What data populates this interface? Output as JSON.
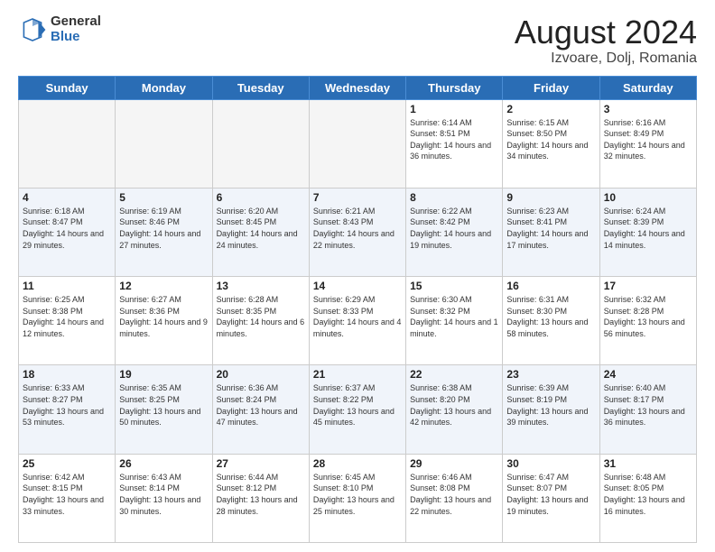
{
  "header": {
    "logo_general": "General",
    "logo_blue": "Blue",
    "month_title": "August 2024",
    "location": "Izvoare, Dolj, Romania"
  },
  "days_of_week": [
    "Sunday",
    "Monday",
    "Tuesday",
    "Wednesday",
    "Thursday",
    "Friday",
    "Saturday"
  ],
  "weeks": [
    [
      {
        "day": "",
        "info": ""
      },
      {
        "day": "",
        "info": ""
      },
      {
        "day": "",
        "info": ""
      },
      {
        "day": "",
        "info": ""
      },
      {
        "day": "1",
        "info": "Sunrise: 6:14 AM\nSunset: 8:51 PM\nDaylight: 14 hours and 36 minutes."
      },
      {
        "day": "2",
        "info": "Sunrise: 6:15 AM\nSunset: 8:50 PM\nDaylight: 14 hours and 34 minutes."
      },
      {
        "day": "3",
        "info": "Sunrise: 6:16 AM\nSunset: 8:49 PM\nDaylight: 14 hours and 32 minutes."
      }
    ],
    [
      {
        "day": "4",
        "info": "Sunrise: 6:18 AM\nSunset: 8:47 PM\nDaylight: 14 hours and 29 minutes."
      },
      {
        "day": "5",
        "info": "Sunrise: 6:19 AM\nSunset: 8:46 PM\nDaylight: 14 hours and 27 minutes."
      },
      {
        "day": "6",
        "info": "Sunrise: 6:20 AM\nSunset: 8:45 PM\nDaylight: 14 hours and 24 minutes."
      },
      {
        "day": "7",
        "info": "Sunrise: 6:21 AM\nSunset: 8:43 PM\nDaylight: 14 hours and 22 minutes."
      },
      {
        "day": "8",
        "info": "Sunrise: 6:22 AM\nSunset: 8:42 PM\nDaylight: 14 hours and 19 minutes."
      },
      {
        "day": "9",
        "info": "Sunrise: 6:23 AM\nSunset: 8:41 PM\nDaylight: 14 hours and 17 minutes."
      },
      {
        "day": "10",
        "info": "Sunrise: 6:24 AM\nSunset: 8:39 PM\nDaylight: 14 hours and 14 minutes."
      }
    ],
    [
      {
        "day": "11",
        "info": "Sunrise: 6:25 AM\nSunset: 8:38 PM\nDaylight: 14 hours and 12 minutes."
      },
      {
        "day": "12",
        "info": "Sunrise: 6:27 AM\nSunset: 8:36 PM\nDaylight: 14 hours and 9 minutes."
      },
      {
        "day": "13",
        "info": "Sunrise: 6:28 AM\nSunset: 8:35 PM\nDaylight: 14 hours and 6 minutes."
      },
      {
        "day": "14",
        "info": "Sunrise: 6:29 AM\nSunset: 8:33 PM\nDaylight: 14 hours and 4 minutes."
      },
      {
        "day": "15",
        "info": "Sunrise: 6:30 AM\nSunset: 8:32 PM\nDaylight: 14 hours and 1 minute."
      },
      {
        "day": "16",
        "info": "Sunrise: 6:31 AM\nSunset: 8:30 PM\nDaylight: 13 hours and 58 minutes."
      },
      {
        "day": "17",
        "info": "Sunrise: 6:32 AM\nSunset: 8:28 PM\nDaylight: 13 hours and 56 minutes."
      }
    ],
    [
      {
        "day": "18",
        "info": "Sunrise: 6:33 AM\nSunset: 8:27 PM\nDaylight: 13 hours and 53 minutes."
      },
      {
        "day": "19",
        "info": "Sunrise: 6:35 AM\nSunset: 8:25 PM\nDaylight: 13 hours and 50 minutes."
      },
      {
        "day": "20",
        "info": "Sunrise: 6:36 AM\nSunset: 8:24 PM\nDaylight: 13 hours and 47 minutes."
      },
      {
        "day": "21",
        "info": "Sunrise: 6:37 AM\nSunset: 8:22 PM\nDaylight: 13 hours and 45 minutes."
      },
      {
        "day": "22",
        "info": "Sunrise: 6:38 AM\nSunset: 8:20 PM\nDaylight: 13 hours and 42 minutes."
      },
      {
        "day": "23",
        "info": "Sunrise: 6:39 AM\nSunset: 8:19 PM\nDaylight: 13 hours and 39 minutes."
      },
      {
        "day": "24",
        "info": "Sunrise: 6:40 AM\nSunset: 8:17 PM\nDaylight: 13 hours and 36 minutes."
      }
    ],
    [
      {
        "day": "25",
        "info": "Sunrise: 6:42 AM\nSunset: 8:15 PM\nDaylight: 13 hours and 33 minutes."
      },
      {
        "day": "26",
        "info": "Sunrise: 6:43 AM\nSunset: 8:14 PM\nDaylight: 13 hours and 30 minutes."
      },
      {
        "day": "27",
        "info": "Sunrise: 6:44 AM\nSunset: 8:12 PM\nDaylight: 13 hours and 28 minutes."
      },
      {
        "day": "28",
        "info": "Sunrise: 6:45 AM\nSunset: 8:10 PM\nDaylight: 13 hours and 25 minutes."
      },
      {
        "day": "29",
        "info": "Sunrise: 6:46 AM\nSunset: 8:08 PM\nDaylight: 13 hours and 22 minutes."
      },
      {
        "day": "30",
        "info": "Sunrise: 6:47 AM\nSunset: 8:07 PM\nDaylight: 13 hours and 19 minutes."
      },
      {
        "day": "31",
        "info": "Sunrise: 6:48 AM\nSunset: 8:05 PM\nDaylight: 13 hours and 16 minutes."
      }
    ]
  ]
}
